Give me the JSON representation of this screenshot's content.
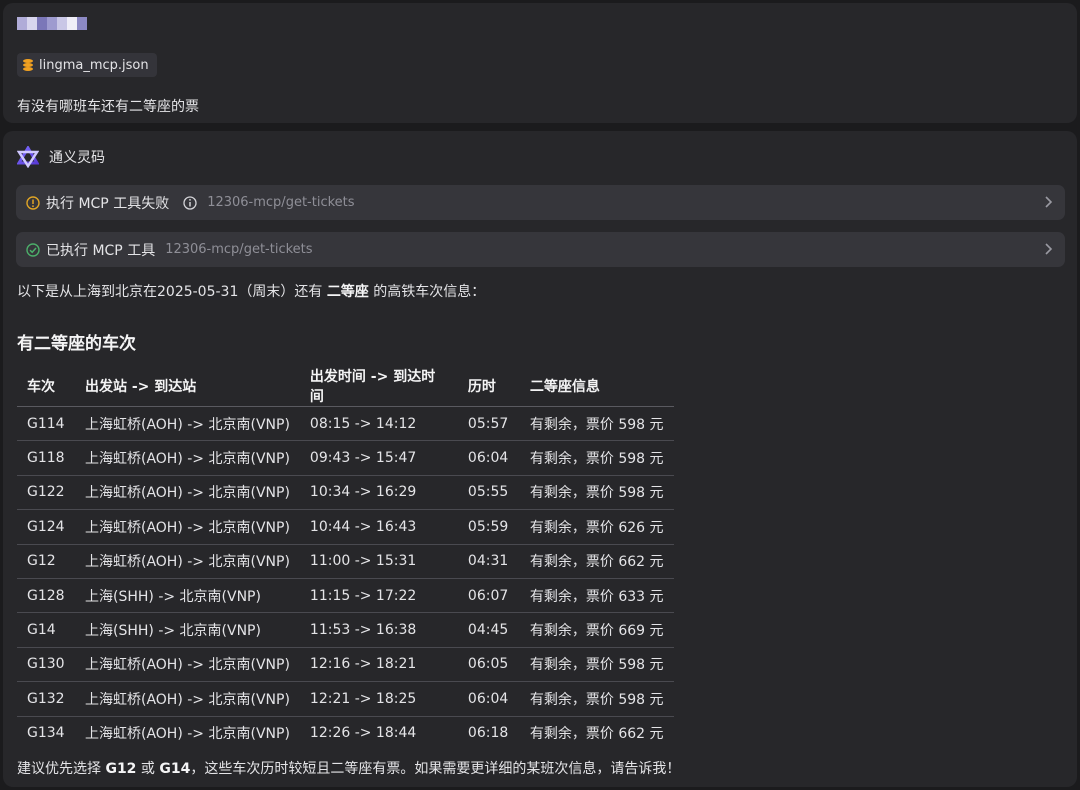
{
  "user": {
    "attachment": "lingma_mcp.json",
    "message": "有没有哪班车还有二等座的票"
  },
  "assistant": {
    "name": "通义灵码",
    "tools": [
      {
        "status": "failed",
        "label": "执行 MCP 工具失败",
        "path": "12306-mcp/get-tickets"
      },
      {
        "status": "success",
        "label": "已执行 MCP 工具",
        "path": "12306-mcp/get-tickets"
      }
    ],
    "intro_prefix": "以下是从上海到北京在2025-05-31（周末）还有 ",
    "intro_bold": "二等座",
    "intro_suffix": " 的高铁车次信息：",
    "section_title": "有二等座的车次",
    "table": {
      "headers": [
        "车次",
        "出发站 -> 到达站",
        "出发时间 -> 到达时间",
        "历时",
        "二等座信息"
      ],
      "rows": [
        [
          "G114",
          "上海虹桥(AOH) -> 北京南(VNP)",
          "08:15 -> 14:12",
          "05:57",
          "有剩余，票价 598 元"
        ],
        [
          "G118",
          "上海虹桥(AOH) -> 北京南(VNP)",
          "09:43 -> 15:47",
          "06:04",
          "有剩余，票价 598 元"
        ],
        [
          "G122",
          "上海虹桥(AOH) -> 北京南(VNP)",
          "10:34 -> 16:29",
          "05:55",
          "有剩余，票价 598 元"
        ],
        [
          "G124",
          "上海虹桥(AOH) -> 北京南(VNP)",
          "10:44 -> 16:43",
          "05:59",
          "有剩余，票价 626 元"
        ],
        [
          "G12",
          "上海虹桥(AOH) -> 北京南(VNP)",
          "11:00 -> 15:31",
          "04:31",
          "有剩余，票价 662 元"
        ],
        [
          "G128",
          "上海(SHH) -> 北京南(VNP)",
          "11:15 -> 17:22",
          "06:07",
          "有剩余，票价 633 元"
        ],
        [
          "G14",
          "上海(SHH) -> 北京南(VNP)",
          "11:53 -> 16:38",
          "04:45",
          "有剩余，票价 669 元"
        ],
        [
          "G130",
          "上海虹桥(AOH) -> 北京南(VNP)",
          "12:16 -> 18:21",
          "06:05",
          "有剩余，票价 598 元"
        ],
        [
          "G132",
          "上海虹桥(AOH) -> 北京南(VNP)",
          "12:21 -> 18:25",
          "06:04",
          "有剩余，票价 598 元"
        ],
        [
          "G134",
          "上海虹桥(AOH) -> 北京南(VNP)",
          "12:26 -> 18:44",
          "06:18",
          "有剩余，票价 662 元"
        ]
      ]
    },
    "advice": {
      "p1": "建议优先选择 ",
      "b1": "G12",
      "p2": " 或 ",
      "b2": "G14",
      "p3": "，这些车次历时较短且二等座有票。如果需要更详细的某班次信息，请告诉我！"
    }
  },
  "colors": {
    "card_bg": "#27272a",
    "tool_bg": "#36363b",
    "warning": "#e0a526",
    "success": "#4cae6a",
    "muted_text": "#8f8f97"
  },
  "icons": {
    "attachment": "database-icon",
    "assistant": "lingma-logo-icon",
    "failed": "warning-circle-icon",
    "info": "info-circle-icon",
    "success": "check-circle-icon",
    "expand": "chevron-right-icon"
  }
}
